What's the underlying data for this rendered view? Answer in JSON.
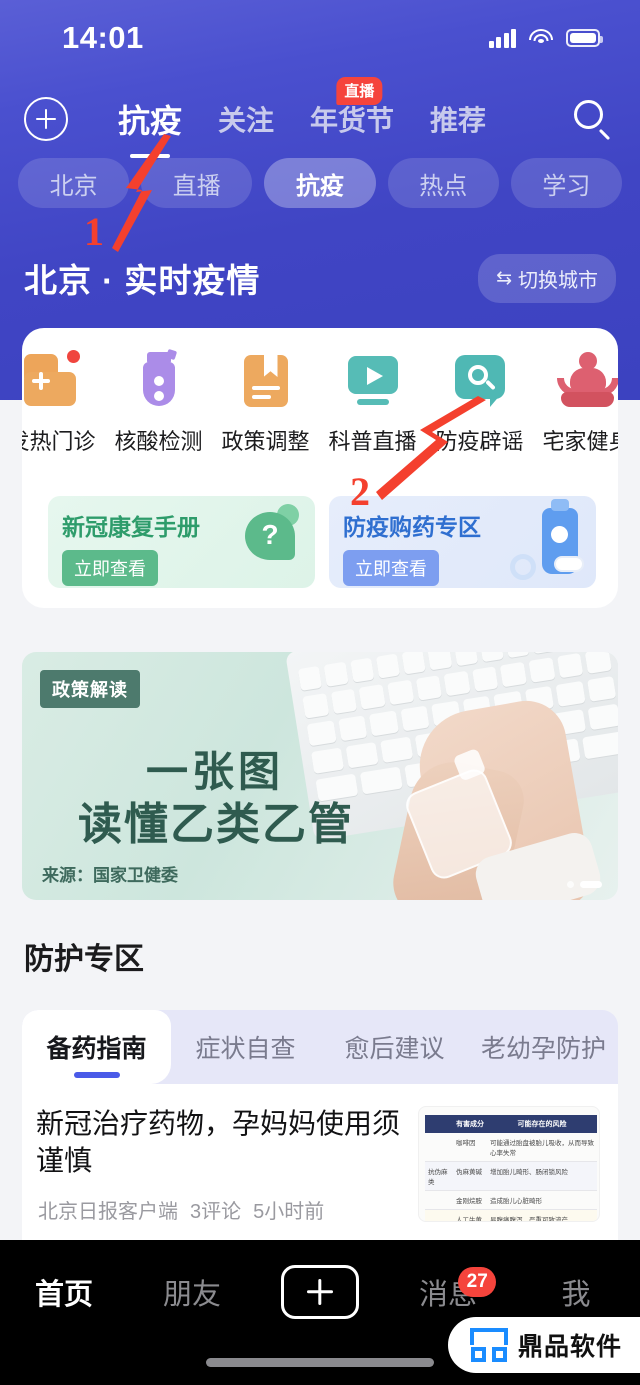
{
  "status_bar": {
    "time": "14:01",
    "signal_icon": "signal-bars-icon",
    "wifi_icon": "wifi-icon",
    "battery_icon": "battery-full-icon"
  },
  "top_nav": {
    "add_icon": "plus-circle-icon",
    "search_icon": "search-icon",
    "tabs": [
      {
        "label": "抗疫",
        "active": true,
        "badge": ""
      },
      {
        "label": "关注",
        "active": false,
        "badge": ""
      },
      {
        "label": "年货节",
        "active": false,
        "badge": "直播"
      },
      {
        "label": "推荐",
        "active": false,
        "badge": ""
      }
    ]
  },
  "chips": [
    {
      "label": "北京",
      "active": false
    },
    {
      "label": "直播",
      "active": false
    },
    {
      "label": "抗疫",
      "active": true
    },
    {
      "label": "热点",
      "active": false
    },
    {
      "label": "学习",
      "active": false
    }
  ],
  "city_section": {
    "title": "北京 · 实时疫情",
    "switch_label": "切换城市",
    "switch_icon": "swap-icon"
  },
  "service_card": {
    "items": [
      {
        "label": "发热门诊",
        "icon": "fever-clinic-icon",
        "has_dot": true
      },
      {
        "label": "核酸检测",
        "icon": "nucleic-acid-test-icon",
        "has_dot": false
      },
      {
        "label": "政策调整",
        "icon": "policy-book-icon",
        "has_dot": false
      },
      {
        "label": "科普直播",
        "icon": "science-live-icon",
        "has_dot": false
      },
      {
        "label": "防疫辟谣",
        "icon": "rumor-search-icon",
        "has_dot": false
      },
      {
        "label": "宅家健身",
        "icon": "home-fitness-icon",
        "has_dot": false
      }
    ],
    "promos": [
      {
        "title": "新冠康复手册",
        "button": "立即查看",
        "theme": "green",
        "art": "question-bubble-art"
      },
      {
        "title": "防疫购药专区",
        "button": "立即查看",
        "theme": "blue",
        "art": "medicine-bottle-art"
      }
    ]
  },
  "banner": {
    "tag": "政策解读",
    "title_line1": "一张图",
    "title_line2": "读懂乙类乙管",
    "source": "来源：国家卫健委",
    "dots_total": 2,
    "dots_active_index": 1
  },
  "protection_section": {
    "title": "防护专区",
    "tabs": [
      {
        "label": "备药指南",
        "active": true
      },
      {
        "label": "症状自查",
        "active": false
      },
      {
        "label": "愈后建议",
        "active": false
      },
      {
        "label": "老幼孕防护",
        "active": false
      }
    ],
    "article": {
      "title": "新冠治疗药物，孕妈妈使用须谨慎",
      "source": "北京日报客户端",
      "comments": "3评论",
      "time": "5小时前",
      "thumbnail": {
        "type": "table",
        "headers": [
          "",
          "有害成分",
          "可能存在的风险"
        ],
        "rows": [
          [
            "",
            "咖啡因",
            "可能通过胎盘被胎儿吸收，从而导致心率失常"
          ],
          [
            "抗伪麻类",
            "伪麻黄碱",
            "增加胎儿畸形、肠闭锁风险"
          ],
          [
            "",
            "金刚烷胺",
            "造成胎儿心脏畸形"
          ],
          [
            "",
            "人工牛黄",
            "易腹痛腹泻，严重可致流产"
          ]
        ]
      }
    }
  },
  "bottom_nav": {
    "items": [
      {
        "label": "首页",
        "active": true,
        "badge": ""
      },
      {
        "label": "朋友",
        "active": false,
        "badge": ""
      },
      {
        "label": "",
        "active": false,
        "badge": "",
        "icon": "plus-box-icon"
      },
      {
        "label": "消息",
        "active": false,
        "badge": "27"
      },
      {
        "label": "我",
        "active": false,
        "badge": ""
      }
    ]
  },
  "watermark": {
    "text": "鼎品软件",
    "logo_icon": "ding-logo-icon"
  },
  "annotations": [
    {
      "number": "1",
      "color": "#f4402e",
      "target": "抗疫 top nav tab"
    },
    {
      "number": "2",
      "color": "#f4402e",
      "target": "防疫辟谣 service icon"
    }
  ],
  "colors": {
    "header_gradient_top": "#5a5fd6",
    "header_gradient_bottom": "#3c42c0",
    "accent_blue": "#4a5ae8",
    "badge_red": "#f5443c",
    "annotation_red": "#f4402e",
    "page_bg": "#f3f4f7"
  }
}
